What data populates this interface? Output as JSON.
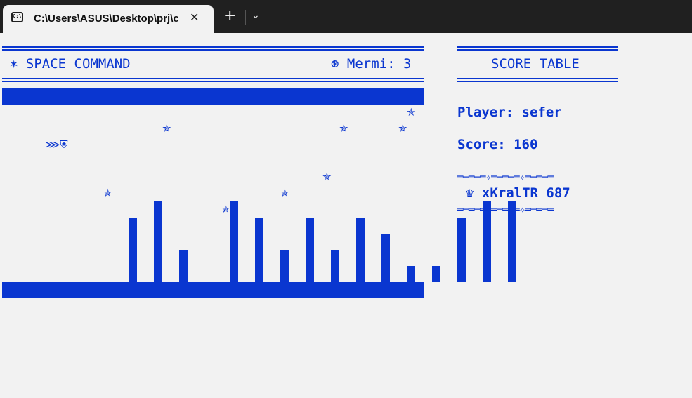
{
  "window": {
    "tab_title": "C:\\Users\\ASUS\\Desktop\\prj\\c",
    "tab_icon": "C:\\",
    "close_glyph": "✕",
    "new_tab_glyph": "+",
    "dropdown_glyph": "⌄"
  },
  "game": {
    "title": "✶ SPACE COMMAND",
    "ammo": "⊛ Mermi: 3",
    "ship": "⋙⛨",
    "star_glyph": "✯",
    "stars_count_shown": 9,
    "column_heights": [
      0,
      0,
      0,
      0,
      0,
      4,
      5,
      2,
      0,
      5,
      4,
      2,
      4,
      2,
      4,
      3,
      1,
      1,
      4,
      5,
      5
    ]
  },
  "score_panel": {
    "header": "SCORE TABLE",
    "player_label": "Player: sefer",
    "score_label": "Score: 160",
    "divider": "═─═─═✧═─═─═✧═─═─═",
    "top_entry": "♛ xKralTR 687"
  }
}
